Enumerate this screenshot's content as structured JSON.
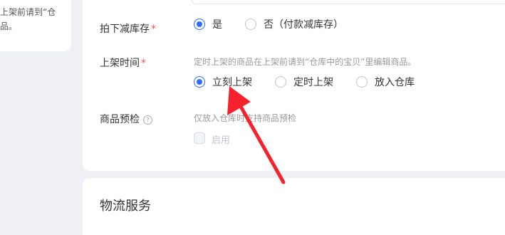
{
  "left_card": {
    "tip": "上架前请到“仓\n品。"
  },
  "inventory": {
    "label": "拍下减库存",
    "required_mark": "*",
    "options": [
      {
        "label": "是",
        "selected": true
      },
      {
        "label": "否（付款减库存）",
        "selected": false
      }
    ]
  },
  "listing_time": {
    "label": "上架时间",
    "required_mark": "*",
    "hint": "定时上架的商品在上架前请到“仓库中的宝贝”里编辑商品。",
    "options": [
      {
        "label": "立刻上架",
        "selected": true
      },
      {
        "label": "定时上架",
        "selected": false
      },
      {
        "label": "放入仓库",
        "selected": false
      }
    ]
  },
  "preinspection": {
    "label": "商品预检",
    "help_glyph": "?",
    "hint": "仅放入仓库时支持商品预检",
    "checkbox_label": "启用",
    "checkbox_checked": false,
    "checkbox_disabled": true
  },
  "logistics": {
    "title": "物流服务"
  },
  "colors": {
    "accent": "#2f6bff",
    "required": "#ff4d4f",
    "arrow": "#f5222d"
  },
  "icons": {
    "help": "question-circle-icon",
    "annotation": "red-arrow-annotation"
  }
}
